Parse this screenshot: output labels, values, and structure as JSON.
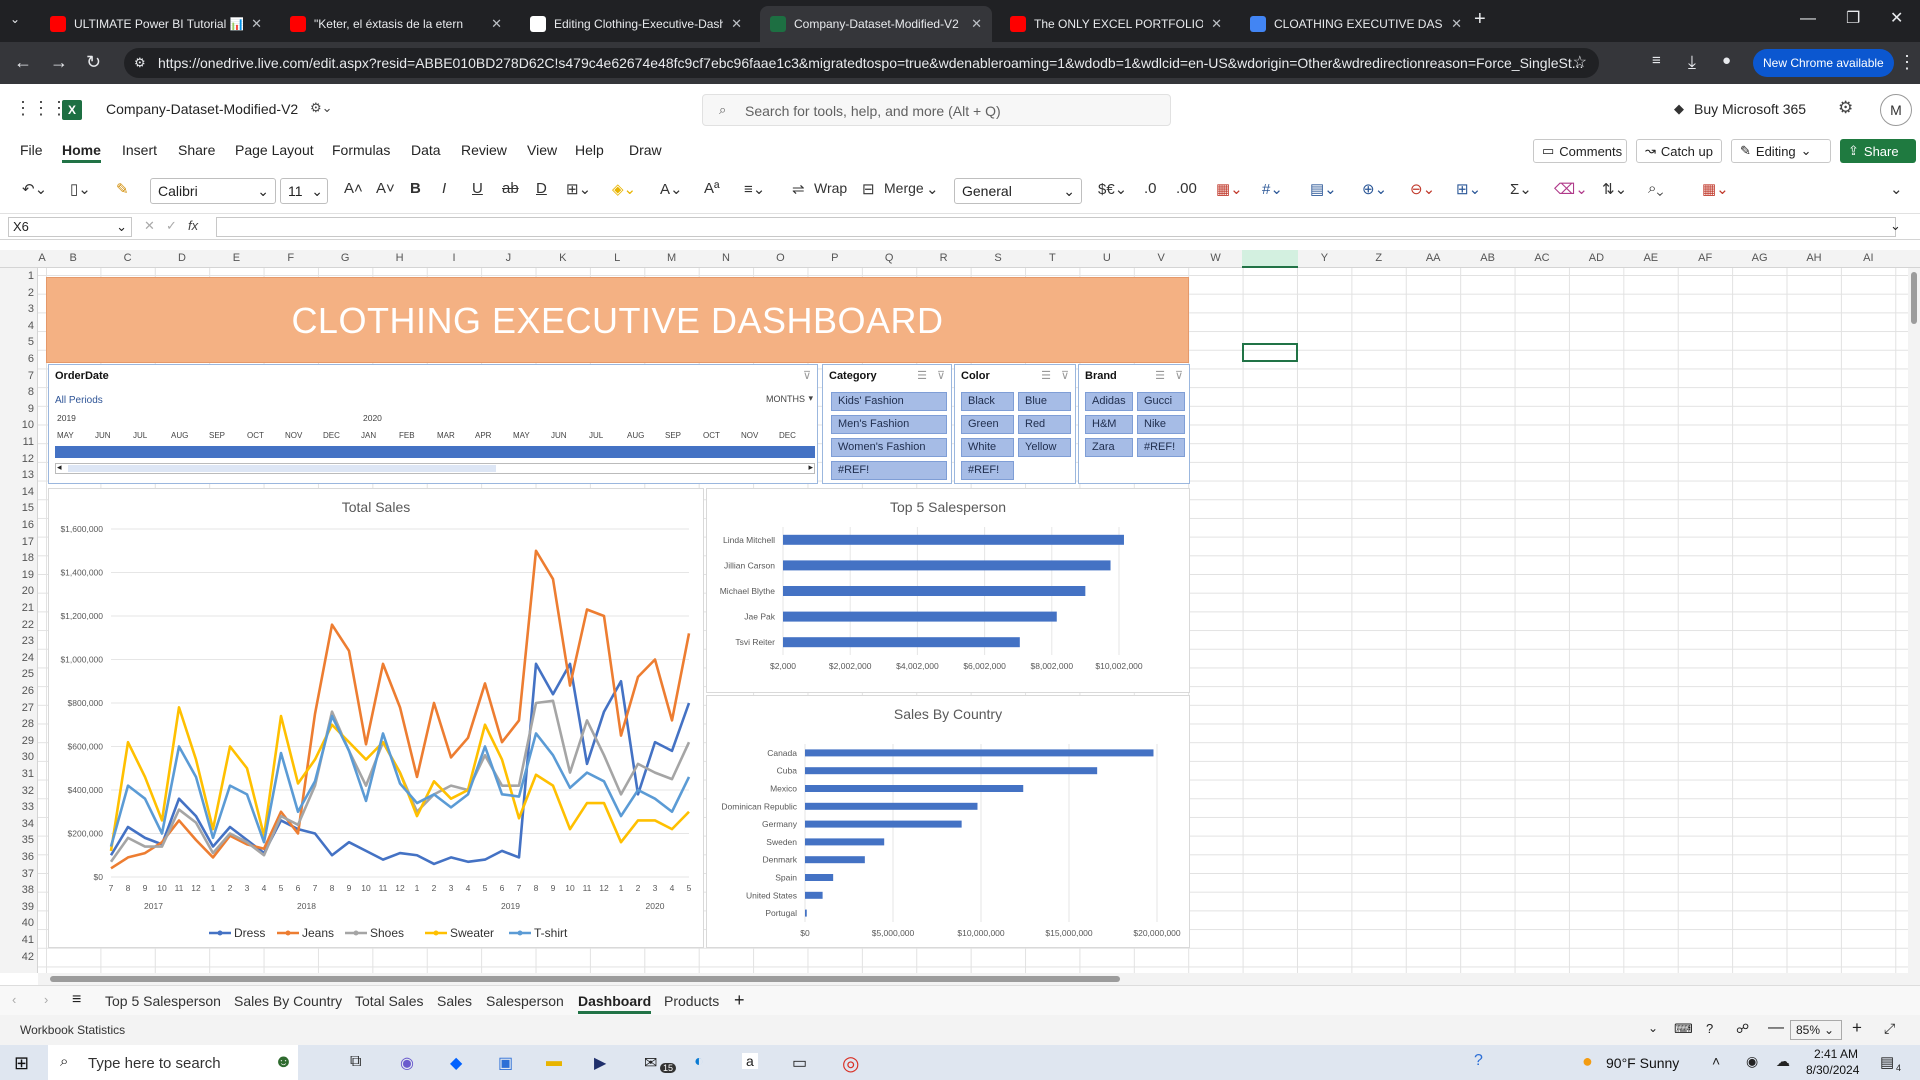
{
  "browser": {
    "tabs": [
      {
        "title": "ULTIMATE Power BI Tutorial 📊",
        "icon": "youtube-icon"
      },
      {
        "title": "\"Keter, el éxtasis de la etern",
        "icon": "youtube-icon"
      },
      {
        "title": "Editing Clothing-Executive-Dash",
        "icon": "github-icon"
      },
      {
        "title": "Company-Dataset-Modified-V2",
        "icon": "excel-icon"
      },
      {
        "title": "The ONLY EXCEL PORTFOLIO PR",
        "icon": "youtube-icon"
      },
      {
        "title": "CLOATHING EXECUTIVE DASHB",
        "icon": "google-icon"
      }
    ],
    "url": "https://onedrive.live.com/edit.aspx?resid=ABBE010BD278D62C!s479c4e62674e48fc9cf7ebc96faae1c3&migratedtospo=true&wdenableroaming=1&wdodb=1&wdlcid=en-US&wdorigin=Other&wdredirectionreason=Force_SingleSt...",
    "new_chrome": "New Chrome available"
  },
  "excel": {
    "file_name": "Company-Dataset-Modified-V2",
    "search_placeholder": "Search for tools, help, and more (Alt + Q)",
    "buy": "Buy Microsoft 365",
    "avatar": "M",
    "menus": [
      "File",
      "Home",
      "Insert",
      "Share",
      "Page Layout",
      "Formulas",
      "Data",
      "Review",
      "View",
      "Help",
      "Draw"
    ],
    "selected_menu": "Home",
    "comments": "Comments",
    "catch_up": "Catch up",
    "editing": "Editing",
    "share": "Share",
    "font": "Calibri",
    "font_size": "11",
    "wrap": "Wrap",
    "merge": "Merge",
    "number_format": "General",
    "cell_ref": "X6",
    "fx": "fx",
    "columns": [
      "A",
      "B",
      "C",
      "D",
      "E",
      "F",
      "G",
      "H",
      "I",
      "J",
      "K",
      "L",
      "M",
      "N",
      "O",
      "P",
      "Q",
      "R",
      "S",
      "T",
      "U",
      "V",
      "W",
      "X",
      "Y",
      "Z",
      "AA",
      "AB",
      "AC",
      "AD",
      "AE",
      "AF",
      "AG",
      "AH",
      "AI"
    ],
    "rows": [
      "1",
      "2",
      "3",
      "4",
      "5",
      "6",
      "7",
      "8",
      "9",
      "10",
      "11",
      "12",
      "13",
      "14",
      "15",
      "16",
      "17",
      "18",
      "19",
      "20",
      "21",
      "22",
      "23",
      "24",
      "25",
      "26",
      "27",
      "28",
      "29",
      "30",
      "31",
      "32",
      "33",
      "34",
      "35",
      "36",
      "37",
      "38",
      "39",
      "40",
      "41",
      "42"
    ]
  },
  "dashboard": {
    "title": "CLOTHING EXECUTIVE DASHBOARD",
    "timeline": {
      "header": "OrderDate",
      "all_periods": "All Periods",
      "unit": "MONTHS",
      "years": [
        "2019",
        "2020"
      ],
      "months": [
        "MAY",
        "JUN",
        "JUL",
        "AUG",
        "SEP",
        "OCT",
        "NOV",
        "DEC",
        "JAN",
        "FEB",
        "MAR",
        "APR",
        "MAY",
        "JUN",
        "JUL",
        "AUG",
        "SEP",
        "OCT",
        "NOV",
        "DEC"
      ]
    },
    "slicers": {
      "category": {
        "header": "Category",
        "items": [
          "Kids' Fashion",
          "Men's Fashion",
          "Women's Fashion",
          "#REF!"
        ]
      },
      "color": {
        "header": "Color",
        "items": [
          "Black",
          "Blue",
          "Green",
          "Red",
          "White",
          "Yellow",
          "#REF!"
        ]
      },
      "brand": {
        "header": "Brand",
        "items": [
          "Adidas",
          "Gucci",
          "H&M",
          "Nike",
          "Zara",
          "#REF!"
        ]
      }
    }
  },
  "chart_data": [
    {
      "type": "line",
      "title": "Total Sales",
      "ylim": [
        0,
        1600000
      ],
      "y_ticks": [
        "$0",
        "$200,000",
        "$400,000",
        "$600,000",
        "$800,000",
        "$1,000,000",
        "$1,200,000",
        "$1,400,000",
        "$1,600,000"
      ],
      "x": [
        "7",
        "8",
        "9",
        "10",
        "11",
        "12",
        "1",
        "2",
        "3",
        "4",
        "5",
        "6",
        "7",
        "8",
        "9",
        "10",
        "11",
        "12",
        "1",
        "2",
        "3",
        "4",
        "5",
        "6",
        "7",
        "8",
        "9",
        "10",
        "11",
        "12",
        "1",
        "2",
        "3",
        "4",
        "5"
      ],
      "year_labels": [
        "2017",
        "2018",
        "2019",
        "2020"
      ],
      "legend_position": "bottom",
      "series": [
        {
          "name": "Dress",
          "color": "#4472c4",
          "values": [
            100000,
            230000,
            180000,
            150000,
            360000,
            280000,
            140000,
            230000,
            170000,
            110000,
            260000,
            220000,
            200000,
            100000,
            160000,
            120000,
            80000,
            110000,
            100000,
            60000,
            90000,
            70000,
            80000,
            120000,
            90000,
            980000,
            840000,
            980000,
            520000,
            760000,
            900000,
            380000,
            620000,
            580000,
            800000
          ]
        },
        {
          "name": "Jeans",
          "color": "#ed7d31",
          "values": [
            40000,
            90000,
            110000,
            160000,
            260000,
            170000,
            90000,
            190000,
            150000,
            130000,
            300000,
            200000,
            750000,
            1160000,
            1040000,
            610000,
            980000,
            780000,
            460000,
            800000,
            550000,
            640000,
            890000,
            620000,
            720000,
            1500000,
            1370000,
            880000,
            1230000,
            1200000,
            650000,
            920000,
            1000000,
            720000,
            1120000
          ]
        },
        {
          "name": "Shoes",
          "color": "#a5a5a5",
          "values": [
            70000,
            180000,
            140000,
            140000,
            310000,
            250000,
            110000,
            200000,
            160000,
            100000,
            280000,
            240000,
            420000,
            760000,
            580000,
            420000,
            620000,
            480000,
            300000,
            380000,
            420000,
            400000,
            560000,
            420000,
            420000,
            800000,
            810000,
            480000,
            720000,
            560000,
            380000,
            520000,
            480000,
            450000,
            620000
          ]
        },
        {
          "name": "Sweater",
          "color": "#ffc000",
          "values": [
            120000,
            620000,
            460000,
            260000,
            780000,
            540000,
            220000,
            600000,
            500000,
            190000,
            740000,
            430000,
            540000,
            700000,
            620000,
            540000,
            620000,
            480000,
            280000,
            440000,
            360000,
            400000,
            700000,
            540000,
            270000,
            470000,
            420000,
            220000,
            340000,
            340000,
            160000,
            260000,
            260000,
            220000,
            300000
          ]
        },
        {
          "name": "T-shirt",
          "color": "#5b9bd5",
          "values": [
            140000,
            420000,
            360000,
            200000,
            600000,
            460000,
            180000,
            420000,
            380000,
            160000,
            570000,
            300000,
            440000,
            740000,
            580000,
            350000,
            660000,
            430000,
            340000,
            380000,
            320000,
            380000,
            600000,
            380000,
            370000,
            660000,
            560000,
            410000,
            480000,
            440000,
            280000,
            400000,
            360000,
            300000,
            460000
          ]
        }
      ]
    },
    {
      "type": "bar",
      "title": "Top 5 Salesperson",
      "categories": [
        "Linda Mitchell",
        "Jillian Carson",
        "Michael Blythe",
        "Jae Pak",
        "Tsvi Reiter"
      ],
      "values": [
        10150000,
        9750000,
        9000000,
        8150000,
        7050000
      ],
      "x_ticks": [
        "$2,000",
        "$2,002,000",
        "$4,002,000",
        "$6,002,000",
        "$8,002,000",
        "$10,002,000"
      ],
      "xlim": [
        2000,
        10002000
      ],
      "color": "#4472c4"
    },
    {
      "type": "bar",
      "title": "Sales By Country",
      "categories": [
        "Canada",
        "Cuba",
        "Mexico",
        "Dominican Republic",
        "Germany",
        "Sweden",
        "Denmark",
        "Spain",
        "United States",
        "Portugal"
      ],
      "values": [
        19800000,
        16600000,
        12400000,
        9800000,
        8900000,
        4500000,
        3400000,
        1600000,
        1000000,
        100000
      ],
      "x_ticks": [
        "$0",
        "$5,000,000",
        "$10,000,000",
        "$15,000,000",
        "$20,000,000"
      ],
      "xlim": [
        0,
        20000000
      ],
      "color": "#4472c4"
    }
  ],
  "sheet_tabs": [
    "Top 5 Salesperson",
    "Sales By Country",
    "Total Sales",
    "Sales",
    "Salesperson",
    "Dashboard",
    "Products"
  ],
  "selected_sheet": "Dashboard",
  "status": {
    "left": "Workbook Statistics",
    "zoom": "85%"
  },
  "taskbar": {
    "search_placeholder": "Type here to search",
    "weather": "90°F  Sunny",
    "time": "2:41 AM",
    "date": "8/30/2024",
    "mail_badge": "15",
    "notif": "4"
  }
}
